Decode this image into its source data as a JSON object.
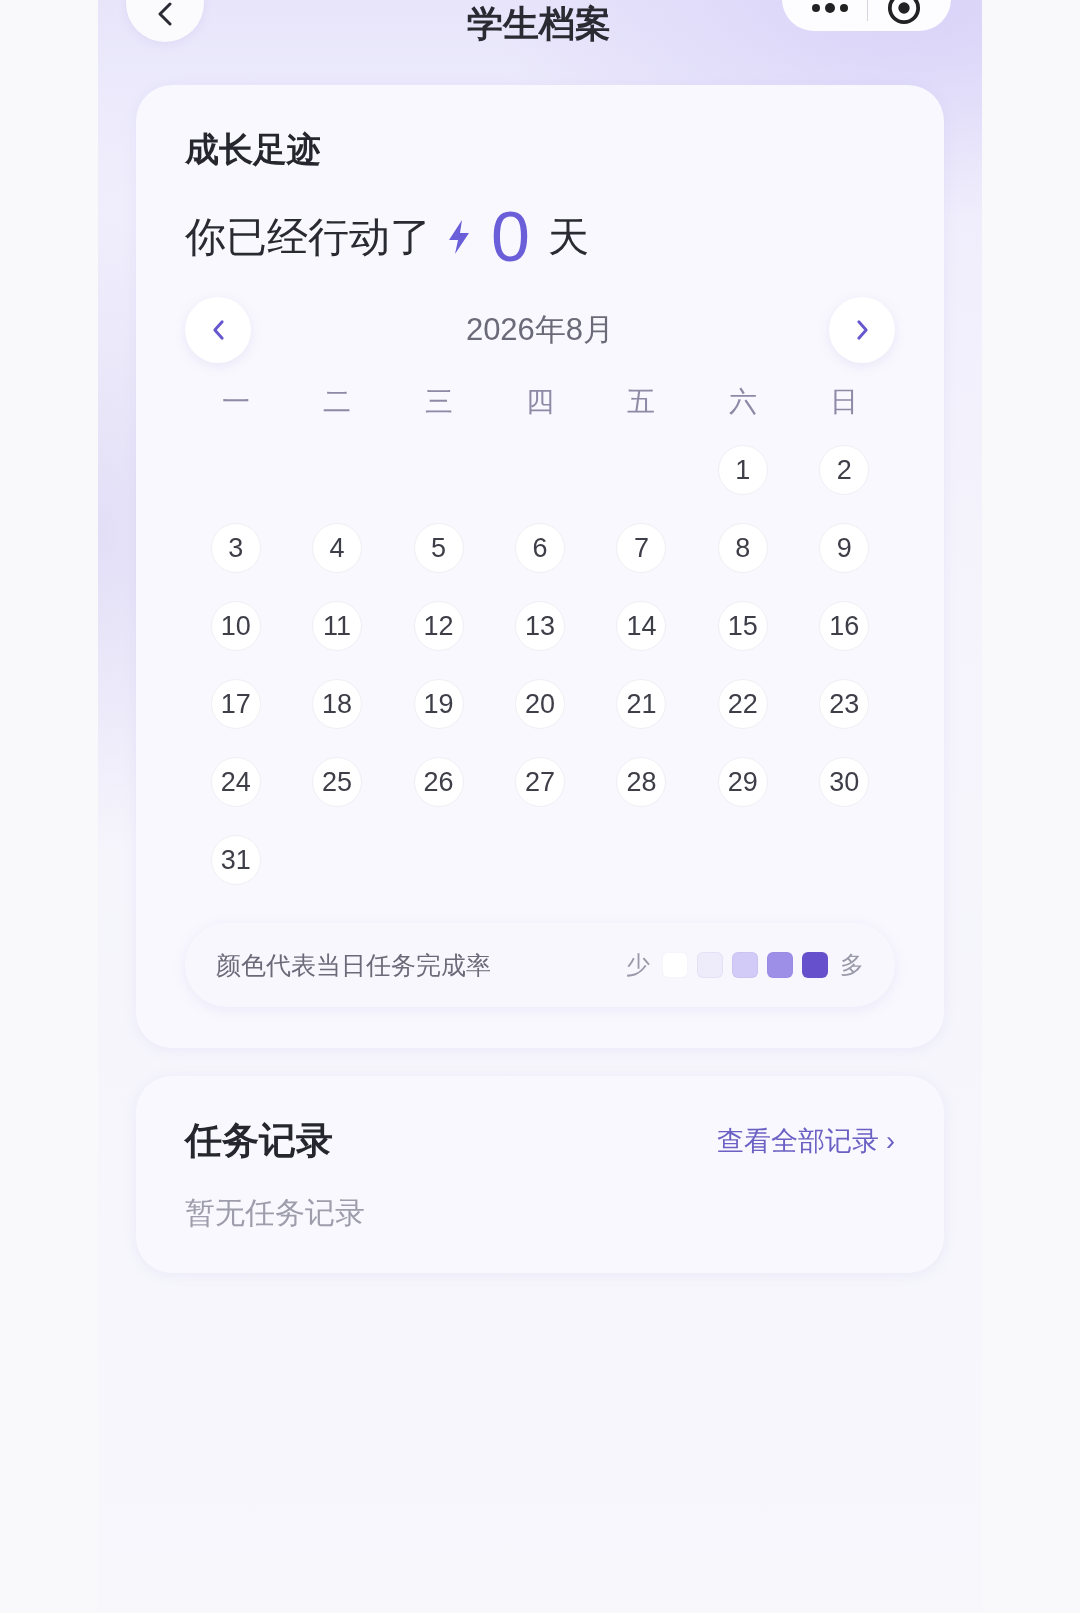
{
  "nav": {
    "title": "学生档案"
  },
  "growth": {
    "title": "成长足迹",
    "streak": {
      "prefix": "你已经行动了",
      "count": "0",
      "suffix": "天"
    },
    "calendar": {
      "month": "2026年8月",
      "weekdays": [
        "一",
        "二",
        "三",
        "四",
        "五",
        "六",
        "日"
      ],
      "weeks": [
        {
          "kind": "leading",
          "days": [
            "1",
            "2"
          ]
        },
        {
          "kind": "full",
          "days": [
            "3",
            "4",
            "5",
            "6",
            "7",
            "8",
            "9"
          ]
        },
        {
          "kind": "full",
          "days": [
            "10",
            "11",
            "12",
            "13",
            "14",
            "15",
            "16"
          ]
        },
        {
          "kind": "full",
          "days": [
            "17",
            "18",
            "19",
            "20",
            "21",
            "22",
            "23"
          ]
        },
        {
          "kind": "full",
          "days": [
            "24",
            "25",
            "26",
            "27",
            "28",
            "29",
            "30"
          ]
        },
        {
          "kind": "trailing",
          "days": [
            "31"
          ]
        }
      ]
    },
    "legend": {
      "text": "颜色代表当日任务完成率",
      "low": "少",
      "high": "多",
      "swatches": [
        {
          "color": "#ffffff"
        },
        {
          "color": "#eeebfb"
        },
        {
          "color": "#d2cbf8"
        },
        {
          "color": "#9d8fe8"
        },
        {
          "color": "#6650cc"
        }
      ]
    }
  },
  "tasks": {
    "title": "任务记录",
    "link": "查看全部记录 ›",
    "empty": "暂无任务记录"
  }
}
